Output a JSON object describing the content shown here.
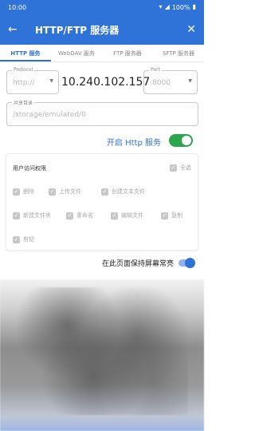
{
  "status_bar": {
    "time": "10:00",
    "battery": "100%"
  },
  "app_bar": {
    "title": "HTTP/FTP 服务器"
  },
  "tabs": [
    {
      "label": "HTTP 服务",
      "active": true
    },
    {
      "label": "WebDAV 服务",
      "active": false
    },
    {
      "label": "FTP 服务器",
      "active": false
    },
    {
      "label": "SFTP 服务器",
      "active": false
    }
  ],
  "protocol": {
    "legend": "Protocol",
    "value": "http://"
  },
  "ip": "10.240.102.157",
  "port": {
    "legend": "Port",
    "value": ":8000"
  },
  "shared_dir": {
    "legend": "共享目录",
    "value": "/storage/emulated/0"
  },
  "service": {
    "label": "开启 Http 服务",
    "enabled": true
  },
  "permissions": {
    "title": "用户访问权限",
    "select_all": "全选",
    "items": [
      "删除",
      "上传文件",
      "创建文本文件",
      "新建文件夹",
      "重命名",
      "编辑文件",
      "复制",
      "剪切"
    ]
  },
  "keep_screen": {
    "label": "在此页面保持屏幕常亮",
    "enabled": true
  },
  "colors": {
    "primary": "#2f73d8",
    "switch_on": "#2ea44f"
  }
}
